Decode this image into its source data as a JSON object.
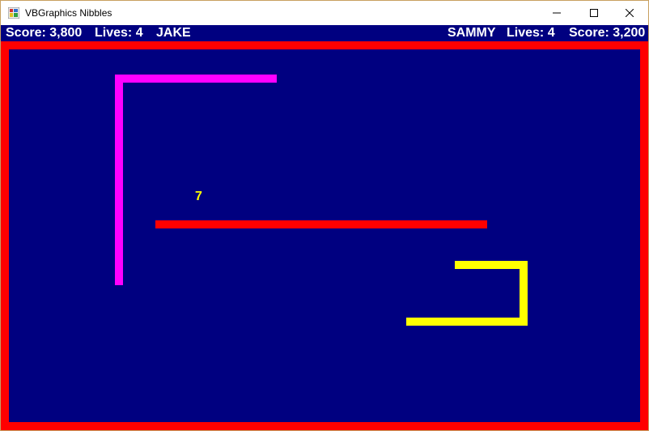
{
  "window": {
    "title": "VBGraphics Nibbles",
    "icon": "application-icon",
    "controls": [
      "minimize-icon",
      "maximize-icon",
      "close-icon"
    ]
  },
  "hud": {
    "player1": {
      "score": "Score: 3,800",
      "lives": "Lives: 4",
      "name": "JAKE"
    },
    "player2": {
      "name": "SAMMY",
      "lives": "Lives: 4",
      "score": "Score: 3,200"
    }
  },
  "game": {
    "target_number": "7",
    "colors": {
      "background": "#000080",
      "wall": "#ff0000",
      "snake_sammy": "#ffff00",
      "snake_jake": "#ff00ff",
      "text": "#ffffff",
      "target": "#ffff00"
    }
  }
}
